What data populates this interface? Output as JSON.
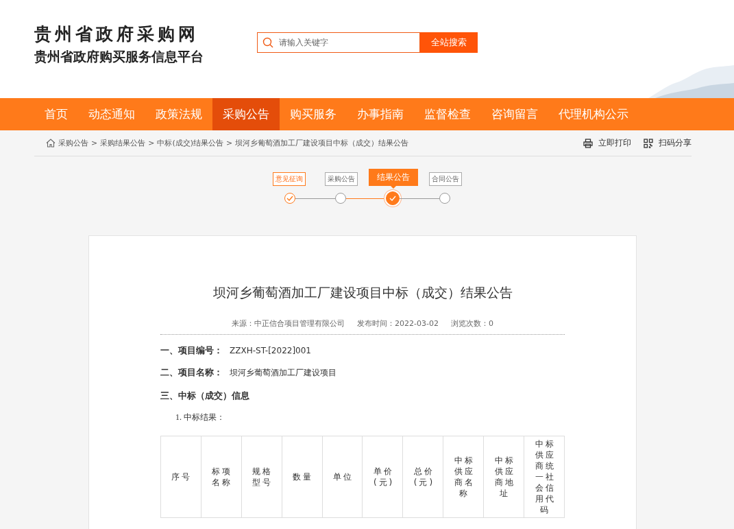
{
  "site": {
    "title": "贵州省政府采购网",
    "subtitle": "贵州省政府购买服务信息平台"
  },
  "search": {
    "placeholder": "请输入关键字",
    "button": "全站搜索"
  },
  "nav": [
    {
      "label": "首页",
      "selected": false
    },
    {
      "label": "动态通知",
      "selected": false
    },
    {
      "label": "政策法规",
      "selected": false
    },
    {
      "label": "采购公告",
      "selected": true
    },
    {
      "label": "购买服务",
      "selected": false
    },
    {
      "label": "办事指南",
      "selected": false
    },
    {
      "label": "监督检查",
      "selected": false
    },
    {
      "label": "咨询留言",
      "selected": false
    },
    {
      "label": "代理机构公示",
      "selected": false
    }
  ],
  "breadcrumb": [
    "采购公告",
    "采购结果公告",
    "中标(成交)结果公告",
    "坝河乡葡萄酒加工厂建设项目中标（成交）结果公告"
  ],
  "breadcrumb_separator": ">",
  "actions": [
    {
      "kind": "print",
      "label": "立即打印"
    },
    {
      "kind": "qr",
      "label": "扫码分享"
    }
  ],
  "steps": [
    {
      "label": "意见征询",
      "done": true,
      "selected": false
    },
    {
      "label": "采购公告",
      "done": false,
      "selected": false
    },
    {
      "label": "结果公告",
      "done": true,
      "selected": true
    },
    {
      "label": "合同公告",
      "done": false,
      "selected": false
    }
  ],
  "article": {
    "title": "坝河乡葡萄酒加工厂建设项目中标（成交）结果公告",
    "meta": [
      "来源：中正信合项目管理有限公司",
      "发布时间：2022-03-02",
      "浏览次数：0"
    ],
    "fields": [
      {
        "label": "一、项目编号：",
        "value": "ZZXH-ST-[2022]001"
      },
      {
        "label": "二、项目名称：",
        "value": "坝河乡葡萄酒加工厂建设项目"
      }
    ],
    "section": "三、中标（成交）信息",
    "subsection": "1. 中标结果：",
    "table": {
      "columns": [
        "序号",
        "标项名称",
        "规格型号",
        "数量",
        "单位",
        "单价(元)",
        "总价(元)",
        "中标供应商名称",
        "中标供应商地址",
        "中标供应商统一社会信用代码"
      ]
    }
  }
}
